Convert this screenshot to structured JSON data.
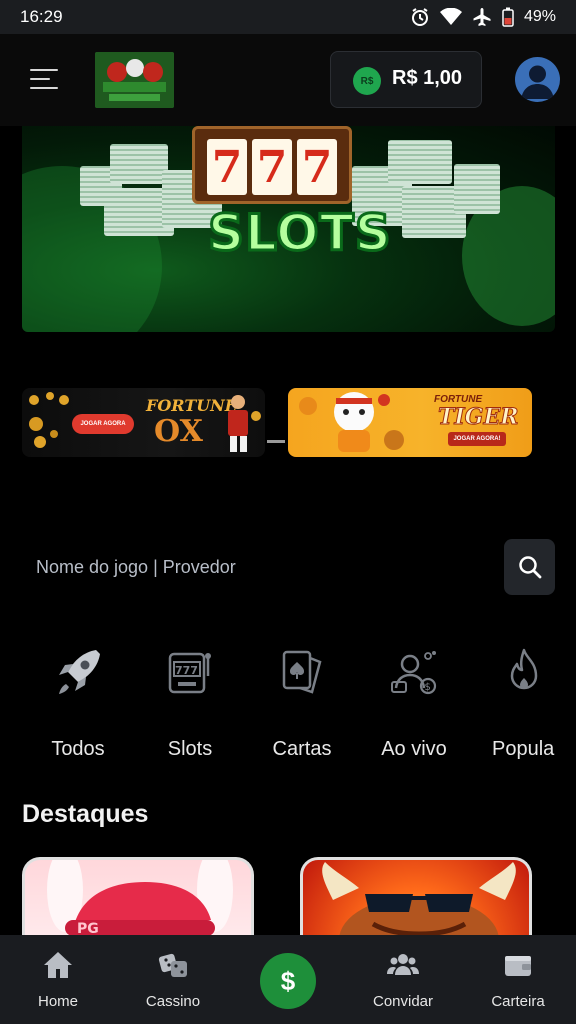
{
  "status_bar": {
    "time": "16:29",
    "battery": "49%",
    "icons": [
      "alarm-icon",
      "wifi-icon",
      "airplane-icon",
      "battery-icon"
    ]
  },
  "header": {
    "menu_icon": "hamburger-menu-icon",
    "balance": {
      "currency_badge": "R$",
      "amount": "R$ 1,00"
    },
    "avatar_icon": "user-avatar-icon"
  },
  "hero": {
    "title": "SLOTS",
    "reels": [
      "7",
      "7",
      "7"
    ]
  },
  "promos": [
    {
      "brand": "FORTUNE",
      "name": "OX",
      "cta": "JOGAR AGORA"
    },
    {
      "brand": "FORTUNE",
      "name": "TIGER",
      "cta": "JOGAR AGORA!"
    }
  ],
  "search": {
    "placeholder": "Nome do jogo | Provedor",
    "icon": "search-icon"
  },
  "categories": [
    {
      "label": "Todos",
      "icon": "rocket-icon"
    },
    {
      "label": "Slots",
      "icon": "slot-machine-icon"
    },
    {
      "label": "Cartas",
      "icon": "cards-icon"
    },
    {
      "label": "Ao vivo",
      "icon": "live-dealer-icon"
    },
    {
      "label": "Popula",
      "icon": "fire-icon"
    }
  ],
  "featured": {
    "title": "Destaques",
    "cards": [
      {
        "badge": "PG"
      },
      {
        "badge": ""
      }
    ]
  },
  "bottom_nav": {
    "items": [
      {
        "label": "Home",
        "icon": "home-icon"
      },
      {
        "label": "Cassino",
        "icon": "dice-icon"
      },
      {
        "label": "$",
        "icon": "deposit-icon"
      },
      {
        "label": "Convidar",
        "icon": "users-icon"
      },
      {
        "label": "Carteira",
        "icon": "wallet-icon"
      }
    ]
  },
  "colors": {
    "background": "#000000",
    "header_bg": "#0a0a0a",
    "accent_green": "#1e8f3a",
    "nav_bg": "#1a1c20"
  }
}
